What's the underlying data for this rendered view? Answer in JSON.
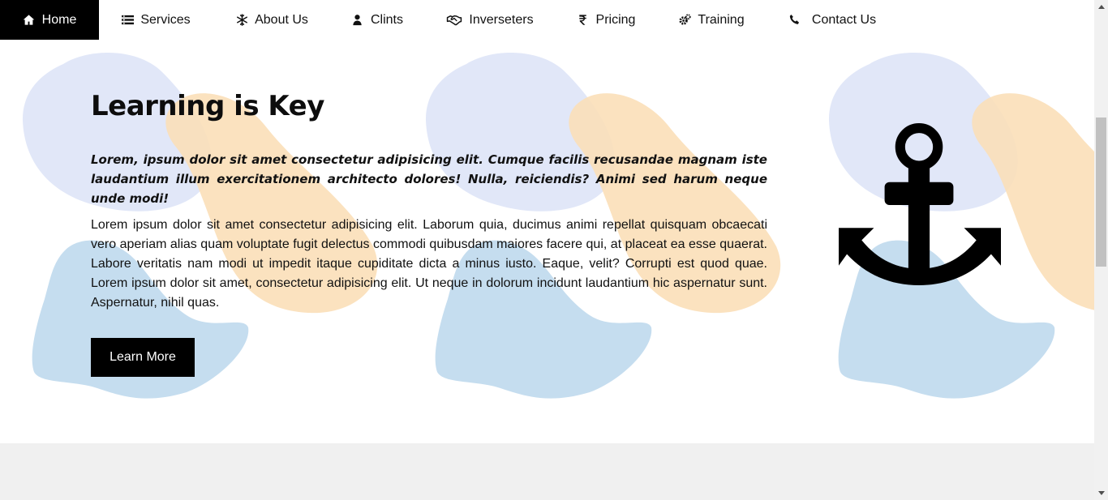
{
  "nav": {
    "items": [
      {
        "label": "Home",
        "icon": "home-icon",
        "active": true
      },
      {
        "label": "Services",
        "icon": "list-icon",
        "active": false
      },
      {
        "label": "About Us",
        "icon": "snowflake-icon",
        "active": false
      },
      {
        "label": "Clints",
        "icon": "user-icon",
        "active": false
      },
      {
        "label": "Inverseters",
        "icon": "handshake-icon",
        "active": false
      },
      {
        "label": "Pricing",
        "icon": "rupee-icon",
        "active": false
      },
      {
        "label": "Training",
        "icon": "cogs-icon",
        "active": false
      },
      {
        "label": "Contact Us",
        "icon": "phone-icon",
        "active": false
      }
    ]
  },
  "hero": {
    "title": "Learning is Key",
    "lead": "Lorem, ipsum dolor sit amet consectetur adipisicing elit. Cumque facilis recusandae magnam iste laudantium illum exercitationem architecto dolores! Nulla, reiciendis? Animi sed harum neque unde modi!",
    "body": "Lorem ipsum dolor sit amet consectetur adipisicing elit. Laborum quia, ducimus animi repellat quisquam obcaecati vero aperiam alias quam voluptate fugit delectus commodi quibusdam maiores facere qui, at placeat ea esse quaerat. Labore veritatis nam modi ut impedit itaque cupiditate dicta a minus iusto. Eaque, velit? Corrupti est quod quae. Lorem ipsum dolor sit amet, consectetur adipisicing elit. Ut neque in dolorum incidunt laudantium hic aspernatur sunt. Aspernatur, nihil quas.",
    "button_label": "Learn More",
    "illustration_icon": "anchor-icon"
  },
  "colors": {
    "nav_active_bg": "#000000",
    "blob_lavender": "#e1e7f8",
    "blob_peach": "#fbdfb8",
    "blob_blue": "#c5ddef",
    "button_bg": "#000000",
    "page_bg": "#f0f0f0"
  }
}
